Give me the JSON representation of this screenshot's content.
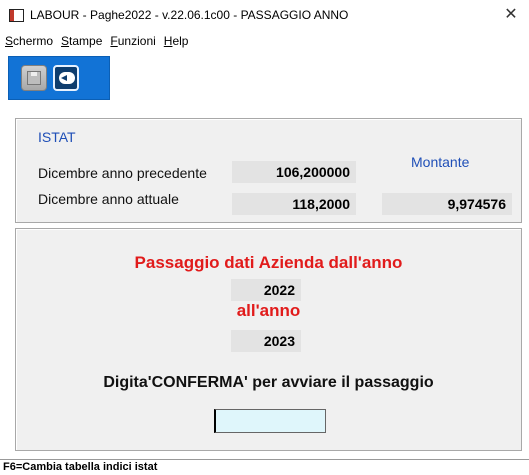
{
  "window": {
    "title": "LABOUR - Paghe2022 - v.22.06.1c00 - PASSAGGIO ANNO",
    "close_glyph": "✕"
  },
  "menu": {
    "items": [
      {
        "accel": "S",
        "rest": "chermo"
      },
      {
        "accel": "S",
        "rest": "tampe"
      },
      {
        "accel": "F",
        "rest": "unzioni"
      },
      {
        "accel": "H",
        "rest": "elp"
      }
    ]
  },
  "toolbar": {
    "buttons": [
      {
        "icon": "save-disk-icon",
        "enabled": false
      },
      {
        "icon": "back-arrow-icon",
        "enabled": true
      }
    ]
  },
  "istat": {
    "title": "ISTAT",
    "prev_label": "Dicembre anno precedente",
    "prev_value": "106,200000",
    "curr_label": "Dicembre anno attuale",
    "curr_value": "118,2000",
    "montante_label": "Montante",
    "montante_value": "9,974576"
  },
  "passaggio": {
    "title": "Passaggio dati Azienda dall'anno",
    "from_year": "2022",
    "to_label": "all'anno",
    "to_year": "2023",
    "confirm_prompt": "Digita'CONFERMA' per avviare il passaggio",
    "confirm_value": ""
  },
  "status": {
    "text": "F6=Cambia tabella indici istat"
  },
  "colors": {
    "accent_blue": "#1273d6",
    "label_blue": "#1f4fb7",
    "title_red": "#e11b1b",
    "input_bg": "#dff6fb"
  }
}
